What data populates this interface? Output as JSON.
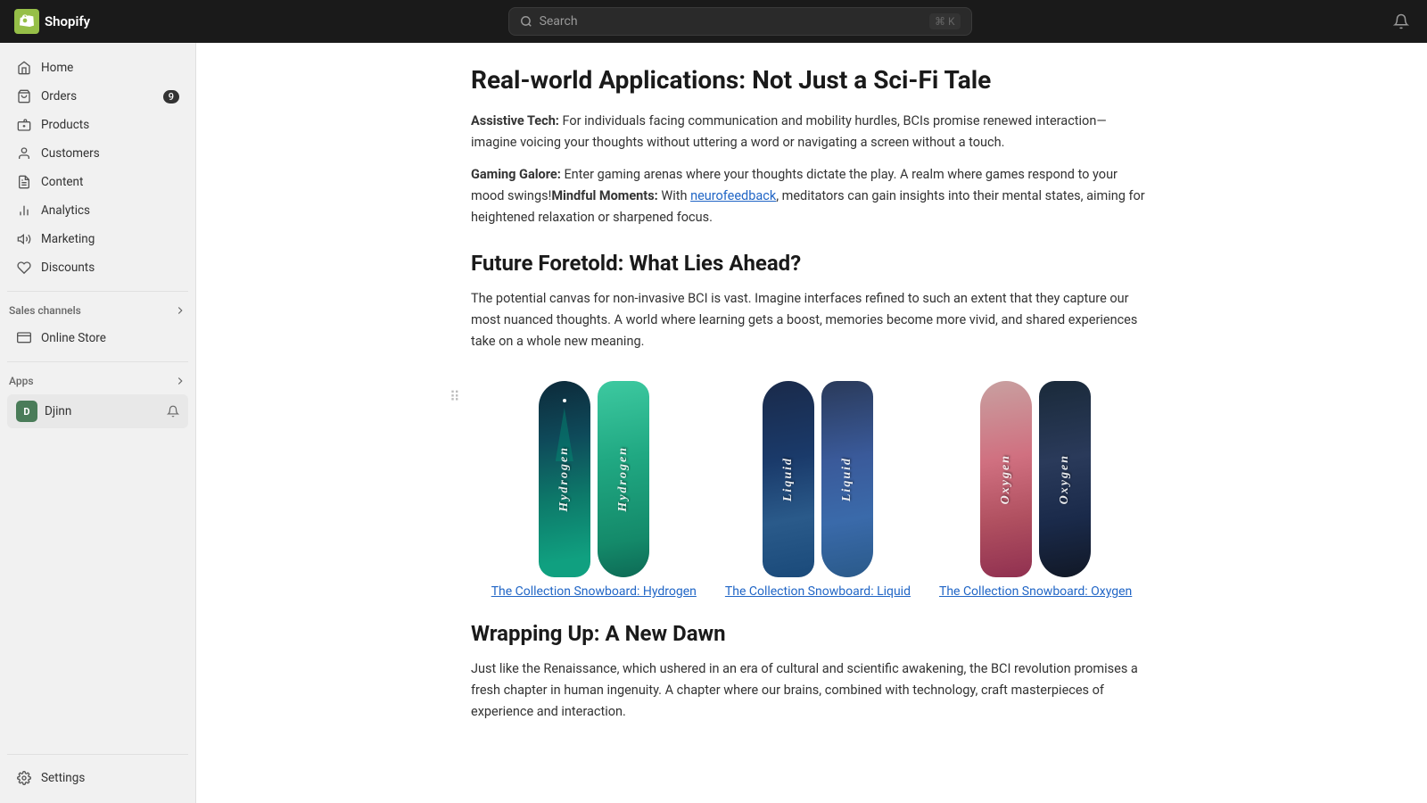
{
  "topbar": {
    "logo_text": "Shopify",
    "search_placeholder": "Search",
    "search_shortcut": "⌘ K",
    "store_name": "Djinn"
  },
  "sidebar": {
    "items": [
      {
        "id": "home",
        "label": "Home",
        "icon": "home"
      },
      {
        "id": "orders",
        "label": "Orders",
        "icon": "orders",
        "badge": "9"
      },
      {
        "id": "products",
        "label": "Products",
        "icon": "products"
      },
      {
        "id": "customers",
        "label": "Customers",
        "icon": "customers"
      },
      {
        "id": "content",
        "label": "Content",
        "icon": "content"
      },
      {
        "id": "analytics",
        "label": "Analytics",
        "icon": "analytics"
      },
      {
        "id": "marketing",
        "label": "Marketing",
        "icon": "marketing"
      },
      {
        "id": "discounts",
        "label": "Discounts",
        "icon": "discounts"
      }
    ],
    "sales_channels_label": "Sales channels",
    "sales_channels": [
      {
        "id": "online-store",
        "label": "Online Store",
        "icon": "store"
      }
    ],
    "apps_label": "Apps",
    "apps_expand_icon": "›",
    "djinn_app": "Djinn",
    "settings_label": "Settings"
  },
  "content": {
    "section1_heading": "Real-world Applications: Not Just a Sci-Fi Tale",
    "assistive_tech_bold": "Assistive Tech:",
    "assistive_tech_text": " For individuals facing communication and mobility hurdles, BCIs promise renewed interaction—imagine voicing your thoughts without uttering a word or navigating a screen without a touch.",
    "gaming_bold": "Gaming Galore:",
    "gaming_text": " Enter gaming arenas where your thoughts dictate the play. A realm where games respond to your mood swings!",
    "mindful_bold": "Mindful Moments:",
    "mindful_text": " With neurofeedback, meditators can gain insights into their mental states, aiming for heightened relaxation or sharpened focus.",
    "section2_heading": "Future Foretold: What Lies Ahead?",
    "future_text": "The potential canvas for non-invasive BCI is vast. Imagine interfaces refined to such an extent that they capture our most nuanced thoughts. A world where learning gets a boost, memories become more vivid, and shared experiences take on a whole new meaning.",
    "product1_name": "The Collection Snowboard: Hydrogen",
    "product2_name": "The Collection Snowboard: Liquid",
    "product3_name": "The Collection Snowboard: Oxygen",
    "section3_heading": "Wrapping Up: A New Dawn",
    "wrapping_text": "Just like the Renaissance, which ushered in an era of cultural and scientific awakening, the BCI revolution promises a fresh chapter in human ingenuity. A chapter where our brains, combined with technology, craft masterpieces of experience and interaction.",
    "product1_label1": "Hydrogen",
    "product2_label1": "Liquid",
    "product3_label1": "Oxygen"
  }
}
